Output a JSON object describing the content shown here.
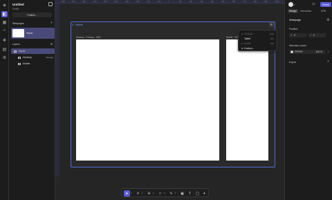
{
  "left_panel": {
    "project_name": "Untitled",
    "project_sub": "Drafts",
    "publish_label": "Publish...",
    "webpages_title": "Webpages",
    "webpage_items": [
      {
        "label": "Home"
      }
    ],
    "layers_title": "Layers",
    "layers": [
      {
        "label": "Home",
        "tag": ""
      },
      {
        "label": "Desktop",
        "tag": "Primary"
      },
      {
        "label": "Mobile",
        "tag": ""
      }
    ]
  },
  "canvas": {
    "frame_title": "Home",
    "breakpoint_desktop": "Desktop · Primary · 1280",
    "breakpoint_mobile": "Mobile · 390",
    "ruler_marks": [
      "-1000",
      "-900",
      "-800",
      "-700",
      "-600",
      "-500",
      "-400",
      "-300",
      "-200",
      "-100",
      "0",
      "100",
      "200",
      "300",
      "400",
      "500",
      "600",
      "700",
      "800",
      "900",
      "1000"
    ],
    "breakpoint_menu": [
      {
        "label": "Desktop",
        "width": "1280",
        "checked": true,
        "enabled": false
      },
      {
        "label": "Tablet",
        "width": "800",
        "checked": false,
        "enabled": true
      },
      {
        "label": "Mobile",
        "width": "390",
        "checked": true,
        "enabled": false
      },
      {
        "label": "Custom...",
        "width": "",
        "checked": false,
        "enabled": true
      }
    ]
  },
  "right_panel": {
    "share_label": "Share",
    "tab_design": "Design",
    "tab_interaction": "Interaction",
    "zoom": "37%",
    "section_title": "Webpage",
    "position_label": "Position",
    "pos_x_axis": "X",
    "pos_x": "0",
    "pos_y_axis": "Y",
    "pos_y": "0",
    "selection_colors_label": "Selection colors",
    "color_hex": "FFFFFF",
    "color_opacity": "100",
    "color_opacity_unit": "%",
    "export_label": "Export"
  }
}
